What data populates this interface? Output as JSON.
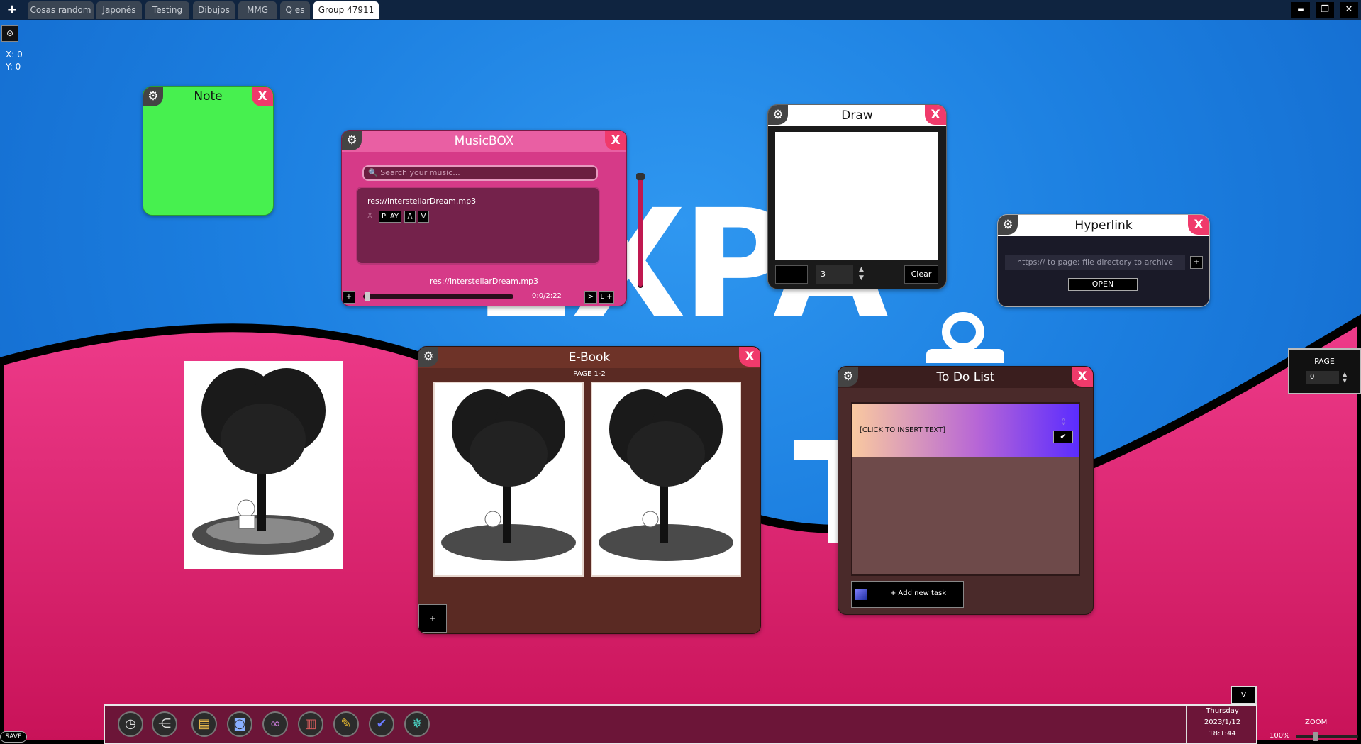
{
  "tabs": {
    "add": "+",
    "items": [
      {
        "label": "Cosas random"
      },
      {
        "label": "Japonés"
      },
      {
        "label": "Testing"
      },
      {
        "label": "Dibujos"
      },
      {
        "label": "MMG"
      },
      {
        "label": "Q es"
      },
      {
        "label": "Group 47911"
      }
    ],
    "active_index": 6
  },
  "window_controls": {
    "minimize": "▬",
    "maximize": "❐",
    "close": "✕"
  },
  "coords": {
    "x": "X: 0",
    "y": "Y: 0",
    "origin_icon": "⊙"
  },
  "background": {
    "text_line1": "EXPA",
    "text_line2": "TE"
  },
  "note": {
    "title": "Note",
    "color": "#47f04f"
  },
  "music": {
    "title": "MusicBOX",
    "search_placeholder": "🔍 Search your music...",
    "track": "res://InterstellarDream.mp3",
    "controls": {
      "x": "X",
      "play": "PLAY",
      "up": "/\\",
      "down": "V"
    },
    "now_playing": "res://InterstellarDream.mp3",
    "time": "0:0/2:22",
    "add": "+",
    "next": ">",
    "loop": "L +",
    "progress": 0.0
  },
  "draw": {
    "title": "Draw",
    "brush_size": "3",
    "clear": "Clear"
  },
  "hyperlink": {
    "title": "Hyperlink",
    "placeholder": "https:// to page; file directory to archive",
    "add": "+",
    "open": "OPEN"
  },
  "ebook": {
    "title": "E-Book",
    "page_label": "PAGE 1-2",
    "add": "+"
  },
  "todo": {
    "title": "To Do List",
    "task": "[CLICK TO INSERT TEXT]",
    "check": "✔",
    "add_task": "+ Add new task"
  },
  "page_widget": {
    "label": "PAGE",
    "value": "0"
  },
  "dock": {
    "collapse": "V",
    "icons": [
      "clock-icon",
      "antenna-icon",
      "notepad-icon",
      "camera-icon",
      "link-icon",
      "books-icon",
      "pencil-icon",
      "checkmark-icon",
      "network-icon"
    ],
    "day": "Thursday",
    "date": "2023/1/12",
    "time": "18:1:44"
  },
  "zoom": {
    "label": "ZOOM",
    "value": "100%"
  },
  "save": "SAVE"
}
